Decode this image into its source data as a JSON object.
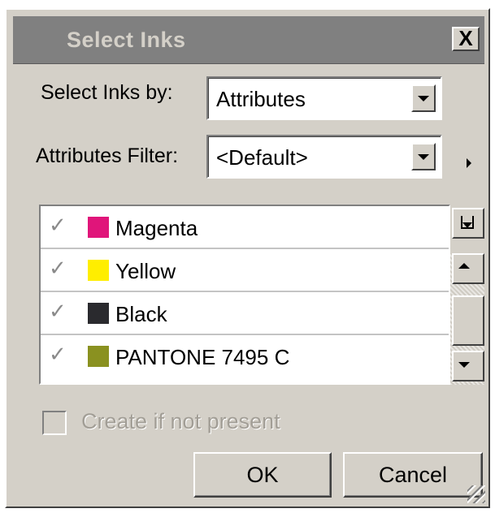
{
  "window": {
    "title": "Select Inks",
    "close_label": "X"
  },
  "select_by": {
    "label": "Select Inks by:",
    "value": "Attributes"
  },
  "filter": {
    "label": "Attributes Filter:",
    "value": "<Default>"
  },
  "inks": [
    {
      "name": "Magenta",
      "checked": true,
      "color": "#e0157a"
    },
    {
      "name": "Yellow",
      "checked": true,
      "color": "#ffee00"
    },
    {
      "name": "Black",
      "checked": true,
      "color": "#2a2a2e"
    },
    {
      "name": "PANTONE 7495 C",
      "checked": true,
      "color": "#8a9120"
    }
  ],
  "check_glyph": "✓",
  "create_option": {
    "label": "Create if not present",
    "checked": false,
    "enabled": false
  },
  "buttons": {
    "ok": "OK",
    "cancel": "Cancel"
  }
}
